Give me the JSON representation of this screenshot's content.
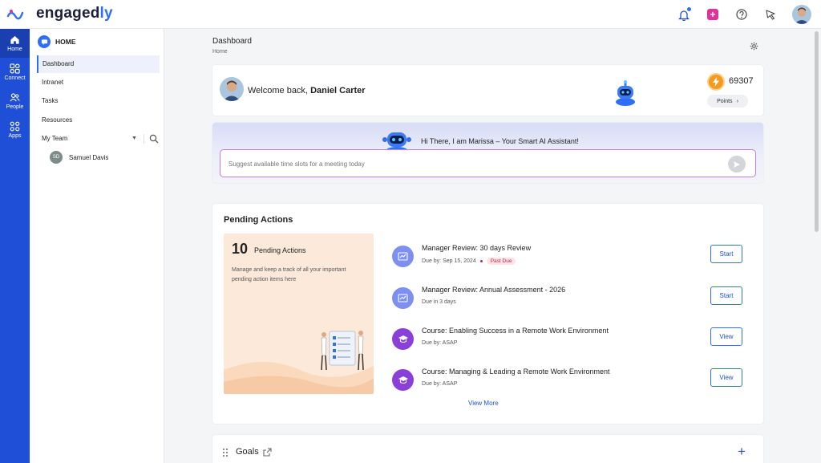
{
  "header": {
    "brand_main": "engaged",
    "brand_accent": "ly",
    "icons": [
      "bell-icon",
      "add-square-icon",
      "help-icon",
      "announcement-icon",
      "user-avatar"
    ]
  },
  "rail": {
    "items": [
      {
        "label": "Home",
        "icon": "home-icon"
      },
      {
        "label": "Connect",
        "icon": "connect-icon"
      },
      {
        "label": "People",
        "icon": "people-icon"
      },
      {
        "label": "Apps",
        "icon": "apps-icon"
      }
    ]
  },
  "sidebar": {
    "heading": "HOME",
    "items": [
      "Dashboard",
      "Intranet",
      "Tasks",
      "Resources"
    ],
    "team_label": "My Team",
    "member": {
      "initials": "SD",
      "name": "Samuel Davis"
    }
  },
  "main": {
    "title": "Dashboard",
    "breadcrumb": "Home",
    "welcome": {
      "prefix": "Welcome back, ",
      "name": "Daniel Carter"
    },
    "points": {
      "value": "69307",
      "button": "Points"
    },
    "assistant": {
      "greeting": "Hi There, I am Marissa – Your Smart AI Assistant!",
      "placeholder": "Suggest available time slots for a meeting today"
    },
    "pending": {
      "title": "Pending Actions",
      "count": "10",
      "count_label": "Pending Actions",
      "description": "Manage and keep a track of all your important pending action items here",
      "items": [
        {
          "name": "Manager Review: 30 days Review",
          "meta": "Due by: Sep 15, 2024",
          "badge": "Past Due",
          "action": "Start",
          "kind": "review"
        },
        {
          "name": "Manager Review: Annual Assessment - 2026",
          "meta": "Due in 3 days",
          "badge": "",
          "action": "Start",
          "kind": "review"
        },
        {
          "name": "Course: Enabling Success in a Remote Work Environment",
          "meta": "Due by: ASAP",
          "badge": "",
          "action": "View",
          "kind": "course"
        },
        {
          "name": "Course: Managing & Leading a Remote Work Environment",
          "meta": "Due by: ASAP",
          "badge": "",
          "action": "View",
          "kind": "course"
        }
      ],
      "view_more": "View More"
    },
    "goals": {
      "title": "Goals"
    }
  },
  "colors": {
    "primary": "#1f4fd6",
    "accent": "#2f6ff5",
    "past_due": "#c2255c",
    "points": "#f39a1f"
  }
}
